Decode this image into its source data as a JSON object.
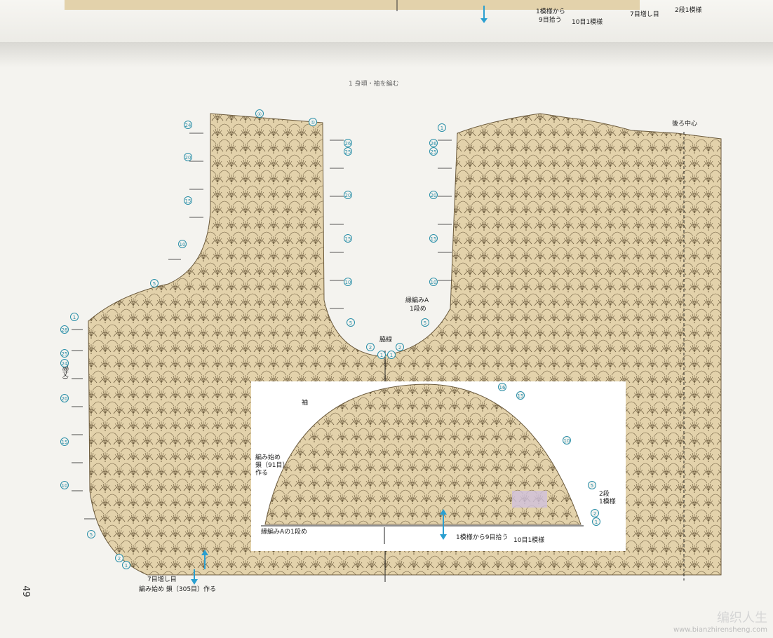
{
  "top_strip": {
    "label_1": "1模様から",
    "label_2": "9目拾う",
    "label_3": "10目1模様",
    "label_4": "7目増し目",
    "label_5": "2段1模様"
  },
  "page_header": "1 身頃・袖を編む",
  "body": {
    "neckline_left_num": "②",
    "neckline_right_num": "①",
    "back_center_label": "後ろ中心",
    "side_seam_label": "脇線",
    "side_length_label": "(脇丈)",
    "edging_a_label": "縁編みA",
    "edging_a_row_label": "1段め",
    "start_label_1": "7目増し目",
    "start_label_2": "編み始め 鎖（305目）作る"
  },
  "left_row_numbers": [
    "24",
    "20",
    "15",
    "10",
    "5",
    "1",
    "28",
    "25",
    "24",
    "20",
    "15",
    "10",
    "5",
    "2",
    "1"
  ],
  "mid_row_numbers": [
    "26",
    "25",
    "20",
    "15",
    "10",
    "5",
    "2",
    "1"
  ],
  "right_row_numbers": [
    "1",
    "26",
    "25",
    "20",
    "15",
    "10",
    "5",
    "2",
    "1"
  ],
  "sleeve": {
    "title": "袖",
    "start_label": "編み始め\n鎖（91目）\n作る",
    "edging_label": "縁編みAの1段め",
    "pickup_label": "1模様から9目拾う",
    "pattern_label": "10目1模様",
    "rows_label": "2段\n1模様",
    "row_numbers": [
      "16",
      "15",
      "10",
      "5",
      "2",
      "1"
    ]
  },
  "page_number": "49",
  "watermark": {
    "title": "编织人生",
    "url": "www.bianzhirensheng.com"
  },
  "colors": {
    "fabric": "#e3d2ab",
    "stitch": "#6b5a3c",
    "marker": "#2a8fa8",
    "arrow_blue": "#2a9fd0"
  }
}
